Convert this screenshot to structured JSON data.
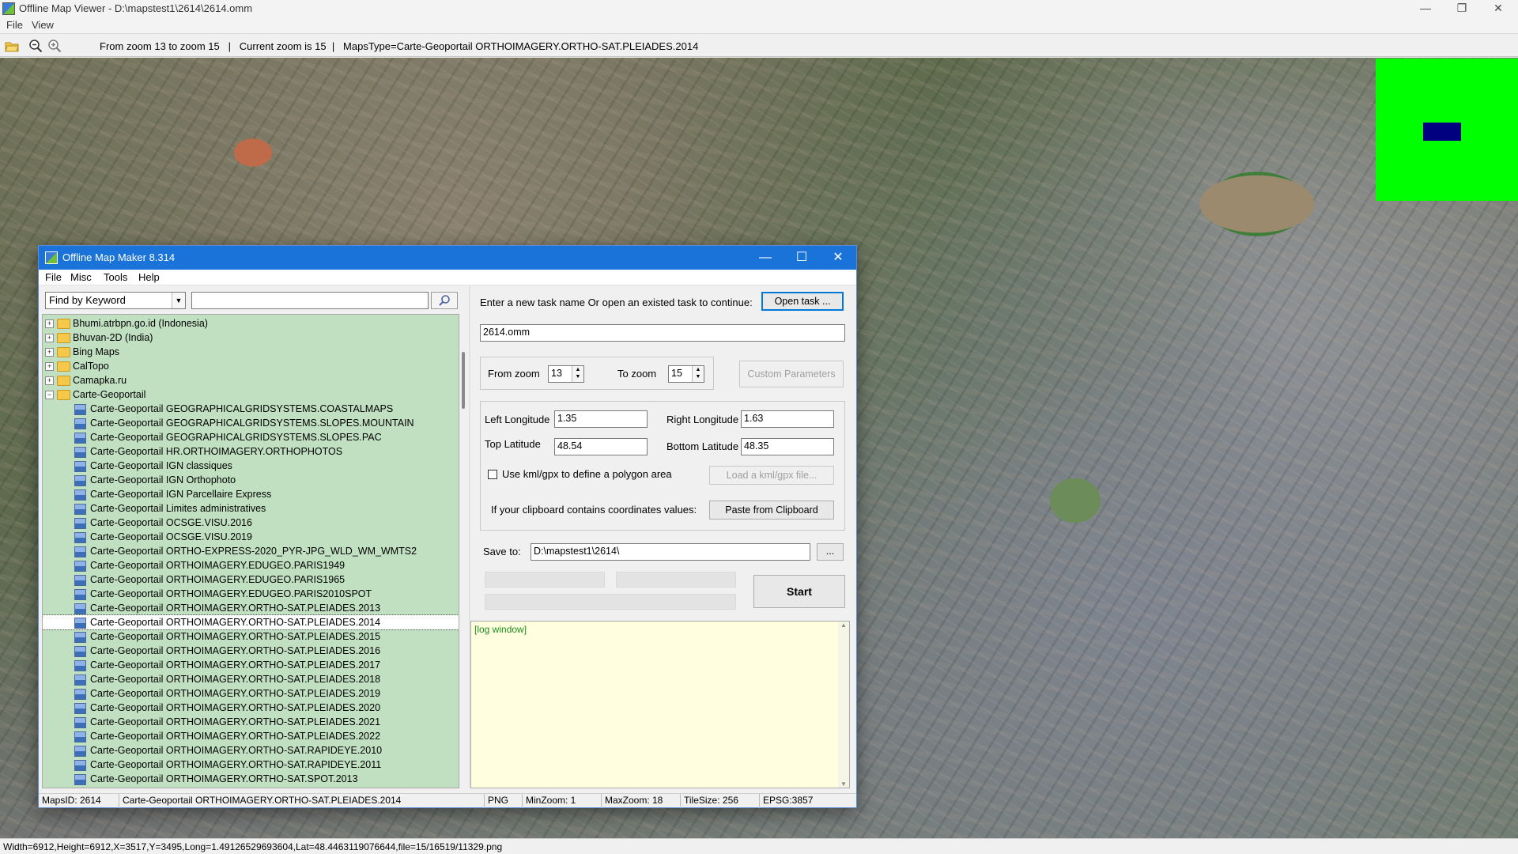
{
  "main_window": {
    "title": "Offline Map Viewer - D:\\mapstest1\\2614\\2614.omm",
    "menu": [
      "File",
      "View"
    ],
    "toolbar_info": "From zoom 13 to zoom 15   |   Current zoom is 15  |   MapsType=Carte-Geoportail ORTHOIMAGERY.ORTHO-SAT.PLEIADES.2014",
    "status": "Width=6912,Height=6912,X=3517,Y=3495,Long=1.49126529693604,Lat=48.4463119076644,file=15/16519/11329.png",
    "minimap_colors": {
      "background": "#00ff00",
      "viewport": "#000080"
    }
  },
  "dialog": {
    "title": "Offline Map Maker 8.314",
    "menu": [
      "File",
      "Misc",
      "Tools",
      "Help"
    ],
    "search": {
      "mode": "Find by Keyword",
      "query": ""
    },
    "tree": {
      "folders_top": [
        "Bhumi.atrbpn.go.id (Indonesia)",
        "Bhuvan-2D (India)",
        "Bing Maps",
        "CalTopo",
        "Camapka.ru"
      ],
      "open_folder": "Carte-Geoportail",
      "children": [
        "Carte-Geoportail GEOGRAPHICALGRIDSYSTEMS.COASTALMAPS",
        "Carte-Geoportail GEOGRAPHICALGRIDSYSTEMS.SLOPES.MOUNTAIN",
        "Carte-Geoportail GEOGRAPHICALGRIDSYSTEMS.SLOPES.PAC",
        "Carte-Geoportail HR.ORTHOIMAGERY.ORTHOPHOTOS",
        "Carte-Geoportail IGN classiques",
        "Carte-Geoportail IGN Orthophoto",
        "Carte-Geoportail IGN Parcellaire Express",
        "Carte-Geoportail Limites administratives",
        "Carte-Geoportail OCSGE.VISU.2016",
        "Carte-Geoportail OCSGE.VISU.2019",
        "Carte-Geoportail ORTHO-EXPRESS-2020_PYR-JPG_WLD_WM_WMTS2",
        "Carte-Geoportail ORTHOIMAGERY.EDUGEO.PARIS1949",
        "Carte-Geoportail ORTHOIMAGERY.EDUGEO.PARIS1965",
        "Carte-Geoportail ORTHOIMAGERY.EDUGEO.PARIS2010SPOT",
        "Carte-Geoportail ORTHOIMAGERY.ORTHO-SAT.PLEIADES.2013",
        "Carte-Geoportail ORTHOIMAGERY.ORTHO-SAT.PLEIADES.2014",
        "Carte-Geoportail ORTHOIMAGERY.ORTHO-SAT.PLEIADES.2015",
        "Carte-Geoportail ORTHOIMAGERY.ORTHO-SAT.PLEIADES.2016",
        "Carte-Geoportail ORTHOIMAGERY.ORTHO-SAT.PLEIADES.2017",
        "Carte-Geoportail ORTHOIMAGERY.ORTHO-SAT.PLEIADES.2018",
        "Carte-Geoportail ORTHOIMAGERY.ORTHO-SAT.PLEIADES.2019",
        "Carte-Geoportail ORTHOIMAGERY.ORTHO-SAT.PLEIADES.2020",
        "Carte-Geoportail ORTHOIMAGERY.ORTHO-SAT.PLEIADES.2021",
        "Carte-Geoportail ORTHOIMAGERY.ORTHO-SAT.PLEIADES.2022",
        "Carte-Geoportail ORTHOIMAGERY.ORTHO-SAT.RAPIDEYE.2010",
        "Carte-Geoportail ORTHOIMAGERY.ORTHO-SAT.RAPIDEYE.2011",
        "Carte-Geoportail ORTHOIMAGERY.ORTHO-SAT.SPOT.2013"
      ],
      "selected": "Carte-Geoportail ORTHOIMAGERY.ORTHO-SAT.PLEIADES.2014"
    },
    "task_prompt": "Enter a new task name Or open an existed task to continue:",
    "open_task_label": "Open task ...",
    "task_name": "2614.omm",
    "from_zoom_label": "From zoom",
    "from_zoom": "13",
    "to_zoom_label": "To zoom",
    "to_zoom": "15",
    "custom_params_label": "Custom Parameters",
    "left_lon_label": "Left Longitude",
    "left_lon": "1.35",
    "right_lon_label": "Right Longitude",
    "right_lon": "1.63",
    "top_lat_label": "Top Latitude",
    "top_lat": "48.54",
    "bottom_lat_label": "Bottom Latitude",
    "bottom_lat": "48.35",
    "kml_label": "Use kml/gpx to define a polygon area",
    "load_kml_label": "Load a kml/gpx file...",
    "clipboard_prompt": "If your clipboard contains coordinates values:",
    "paste_label": "Paste from Clipboard",
    "save_to_label": "Save to:",
    "save_to": "D:\\mapstest1\\2614\\",
    "browse_label": "...",
    "start_label": "Start",
    "log_text": "[log window]",
    "status": {
      "maps_id": "MapsID: 2614",
      "maps_name": "Carte-Geoportail ORTHOIMAGERY.ORTHO-SAT.PLEIADES.2014",
      "format": "PNG",
      "min_zoom": "MinZoom: 1",
      "max_zoom": "MaxZoom: 18",
      "tile_size": "TileSize: 256",
      "epsg": "EPSG:3857"
    }
  }
}
